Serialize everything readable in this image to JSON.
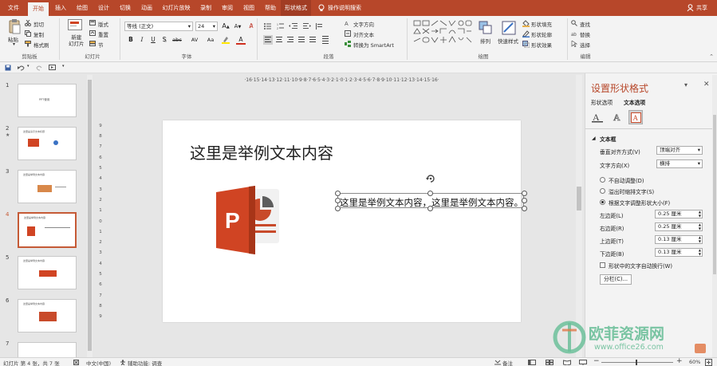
{
  "tabs": [
    {
      "label": "文件"
    },
    {
      "label": "开始"
    },
    {
      "label": "插入"
    },
    {
      "label": "绘图"
    },
    {
      "label": "设计"
    },
    {
      "label": "切换"
    },
    {
      "label": "动画"
    },
    {
      "label": "幻灯片放映"
    },
    {
      "label": "录制"
    },
    {
      "label": "审阅"
    },
    {
      "label": "视图"
    },
    {
      "label": "帮助"
    },
    {
      "label": "形状格式"
    }
  ],
  "tell_me": "操作说明搜索",
  "share": "共享",
  "ribbon": {
    "clipboard": {
      "paste": "粘贴",
      "cut": "剪切",
      "copy": "复制",
      "format_painter": "格式刷",
      "label": "剪贴板"
    },
    "slides": {
      "new_slide": "新建\n幻灯片",
      "layout": "版式",
      "reset": "重置",
      "section": "节",
      "label": "幻灯片"
    },
    "font": {
      "font_name": "等线 (正文)",
      "font_size": "24",
      "label": "字体",
      "bold": "B",
      "italic": "I",
      "underline": "U",
      "shadow": "S",
      "strike": "abc",
      "char_spacing": "AV",
      "case": "Aa"
    },
    "paragraph": {
      "text_direction": "文字方向",
      "align_text": "对齐文本",
      "convert_smartart": "转换为 SmartArt",
      "label": "段落"
    },
    "drawing": {
      "arrange": "排列",
      "quick_styles": "快速样式",
      "shape_fill": "形状填充",
      "shape_outline": "形状轮廓",
      "shape_effects": "形状效果",
      "label": "绘图"
    },
    "editing": {
      "find": "查找",
      "replace": "替换",
      "select": "选择",
      "label": "编辑"
    }
  },
  "ruler_h": "·16·15·14·13·12·11·10·9·8·7·6·5·4·3·2·1·0·1·2·3·4·5·6·7·8·9·10·11·12·13·14·15·16·",
  "ruler_v": [
    "9",
    "8",
    "7",
    "6",
    "5",
    "4",
    "3",
    "2",
    "1",
    "0",
    "1",
    "2",
    "3",
    "4",
    "5",
    "6",
    "7",
    "8",
    "9"
  ],
  "thumbnails": [
    {
      "num": "1",
      "title": "PPT使用"
    },
    {
      "num": "2",
      "title": "这里是演示文本标题"
    },
    {
      "num": "3",
      "title": "这里是举例文本内容"
    },
    {
      "num": "4",
      "title": "这里是举例文本内容"
    },
    {
      "num": "5",
      "title": "这里是举例文本内容"
    },
    {
      "num": "6",
      "title": "这里是举例文本内容"
    },
    {
      "num": "7",
      "title": ""
    }
  ],
  "slide": {
    "title": "这里是举例文本内容",
    "textbox": "这里是举例文本内容，这里是举例文本内容。"
  },
  "pane": {
    "title": "设置形状格式",
    "tab_shape": "形状选项",
    "tab_text": "文本选项",
    "section": "文本框",
    "valign_label": "垂直对齐方式(V)",
    "valign_value": "顶端对齐",
    "direction_label": "文字方向(X)",
    "direction_value": "横排",
    "opt_no_autofit": "不自动调整(D)",
    "opt_shrink": "溢出时缩排文字(S)",
    "opt_resize": "根据文字调整形状大小(F)",
    "left_label": "左边距(L)",
    "left_value": "0.25 厘米",
    "right_label": "右边距(R)",
    "right_value": "0.25 厘米",
    "top_label": "上边距(T)",
    "top_value": "0.13 厘米",
    "bottom_label": "下边距(B)",
    "bottom_value": "0.13 厘米",
    "wrap_label": "形状中的文字自动换行(W)",
    "columns_button": "分栏(C)..."
  },
  "status": {
    "slide_info": "幻灯片 第 4 张，共 7 张",
    "language": "中文(中国)",
    "accessibility": "辅助功能: 调查",
    "notes": "备注",
    "zoom": "60%"
  },
  "watermark": {
    "brand": "欧菲资源网",
    "url": "www.office26.com"
  },
  "colors": {
    "accent": "#b7472a",
    "selection": "#c55a36",
    "ppt_orange": "#d04423"
  }
}
